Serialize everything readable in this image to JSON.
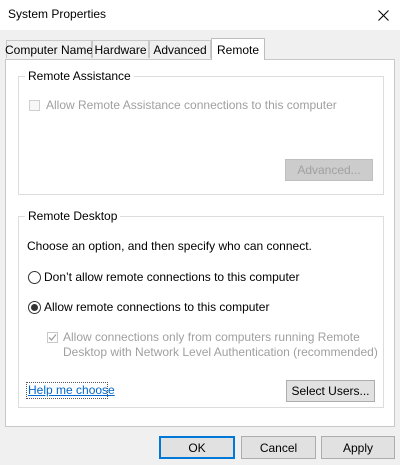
{
  "window": {
    "title": "System Properties",
    "close_glyph": "✕"
  },
  "tabs": [
    {
      "label": "Computer Name",
      "active": false
    },
    {
      "label": "Hardware",
      "active": false
    },
    {
      "label": "Advanced",
      "active": false
    },
    {
      "label": "Remote",
      "active": true
    }
  ],
  "remote_assistance": {
    "group_title": "Remote Assistance",
    "allow_checkbox_label": "Allow Remote Assistance connections to this computer",
    "allow_checked": false,
    "advanced_button": "Advanced..."
  },
  "remote_desktop": {
    "group_title": "Remote Desktop",
    "instruction": "Choose an option, and then specify who can connect.",
    "option_dont_allow": "Don’t allow remote connections to this computer",
    "option_allow": "Allow remote connections to this computer",
    "selected_option": "allow",
    "nla_label_line1": "Allow connections only from computers running Remote",
    "nla_label_line2": "Desktop with Network Level Authentication (recommended)",
    "nla_checked": true,
    "help_link": "Help me choose",
    "select_users_button": "Select Users..."
  },
  "buttons": {
    "ok": "OK",
    "cancel": "Cancel",
    "apply": "Apply"
  },
  "colors": {
    "accent": "#0078d7",
    "link": "#0066cc",
    "disabled_text": "#a0a0a0"
  }
}
